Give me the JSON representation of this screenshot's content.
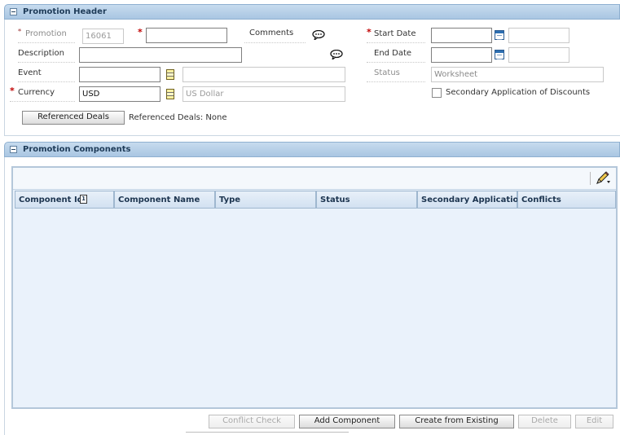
{
  "header_section": {
    "title": "Promotion Header",
    "promotion_label": "Promotion",
    "promotion_id": "16061",
    "promotion_name_value": "",
    "comments_label": "Comments",
    "start_date_label": "Start Date",
    "start_date_value": "",
    "start_time_value": "",
    "description_label": "Description",
    "description_value": "",
    "end_date_label": "End Date",
    "end_date_value": "",
    "end_time_value": "",
    "event_label": "Event",
    "event_value": "",
    "event_desc_value": "",
    "status_label": "Status",
    "status_value": "Worksheet",
    "currency_label": "Currency",
    "currency_value": "USD",
    "currency_desc_value": "US Dollar",
    "secondary_label": "Secondary Application of Discounts",
    "secondary_checked": false,
    "referenced_deals_button": "Referenced Deals",
    "referenced_deals_text": "Referenced Deals: None",
    "required_marker": "*"
  },
  "components_section": {
    "title": "Promotion Components",
    "columns": [
      "Component Id",
      "Component Name",
      "Type",
      "Status",
      "Secondary Application",
      "Conflicts"
    ],
    "rows": [],
    "sort_indicator": "1",
    "buttons": {
      "conflict_check": "Conflict Check",
      "add_component": "Add Component",
      "create_from_existing": "Create from Existing",
      "delete": "Delete",
      "edit": "Edit"
    }
  },
  "icons": {
    "section_toggle": "minus-icon",
    "comments": "speech-bubble-icon",
    "calendar": "calendar-icon",
    "lov": "list-of-values-icon",
    "edit_pencil": "pencil-icon"
  },
  "colors": {
    "section_bar": "#b8d0e8",
    "section_title": "#1e3b58",
    "table_bg": "#eaf2fb",
    "required": "#c00000"
  }
}
